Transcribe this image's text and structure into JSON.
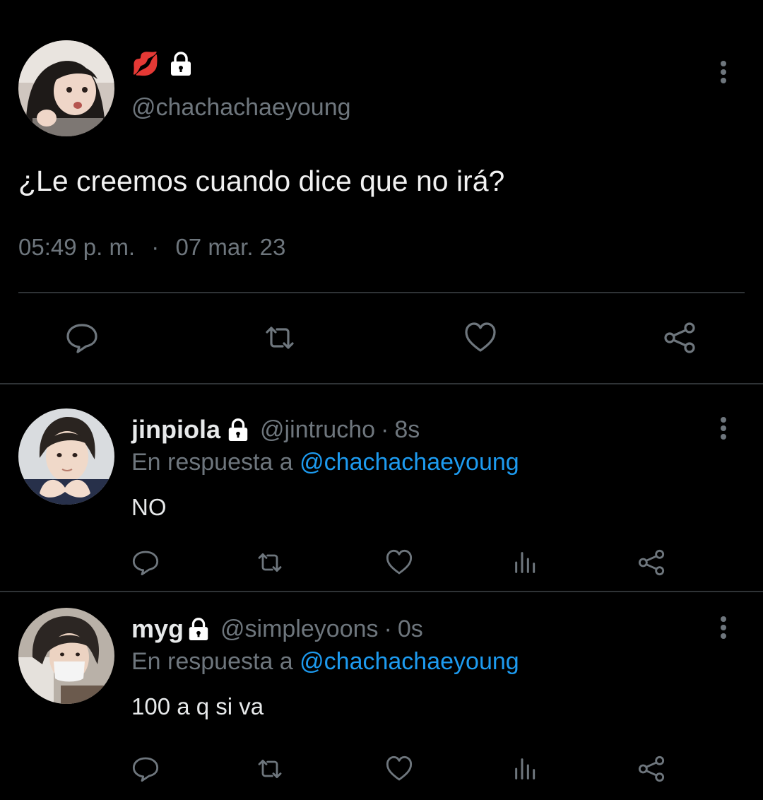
{
  "main_tweet": {
    "name_emoji": "💋",
    "handle": "@chachachaeyoung",
    "text": "¿Le creemos cuando dice que no irá?",
    "time": "05:49 p. m.",
    "separator": "·",
    "date": "07 mar. 23",
    "actions": [
      "reply-icon",
      "retweet-icon",
      "like-icon",
      "share-icon"
    ]
  },
  "replies": [
    {
      "name": "jinpiola",
      "handle": "@jintrucho",
      "dot": "·",
      "age": "8s",
      "in_reply_prefix": "En respuesta a",
      "in_reply_to": "@chachachaeyoung",
      "text": "NO"
    },
    {
      "name": "myg",
      "handle": "@simpleyoons",
      "dot": "·",
      "age": "0s",
      "in_reply_prefix": "En respuesta a",
      "in_reply_to": "@chachachaeyoung",
      "text": "100 a q si va"
    }
  ],
  "colors": {
    "background": "#000000",
    "text": "#e7e9ea",
    "muted": "#6e767d",
    "link": "#1d9bf0",
    "divider": "#2f3336"
  }
}
